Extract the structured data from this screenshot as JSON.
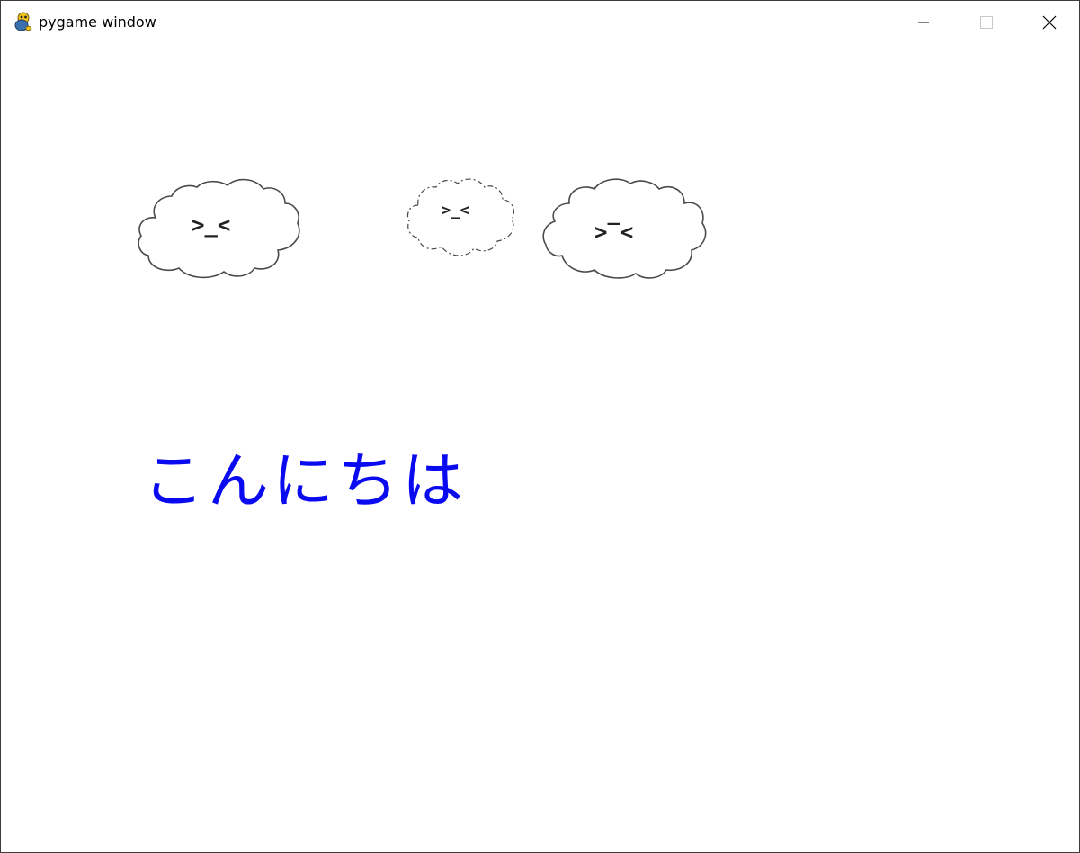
{
  "window": {
    "title": "pygame window",
    "app_icon": "pygame-snake-icon",
    "controls": {
      "minimize_icon": "minimize-icon",
      "maximize_icon": "maximize-icon",
      "close_icon": "close-icon"
    }
  },
  "scene": {
    "background_color": "#ffffff",
    "clouds": [
      {
        "face": ">_<",
        "outline": "solid"
      },
      {
        "face": ">_<",
        "outline": "dashed"
      },
      {
        "face": ">‾<",
        "outline": "solid"
      }
    ],
    "greeting": {
      "text": "こんにちは",
      "color": "#0a0af0"
    }
  }
}
